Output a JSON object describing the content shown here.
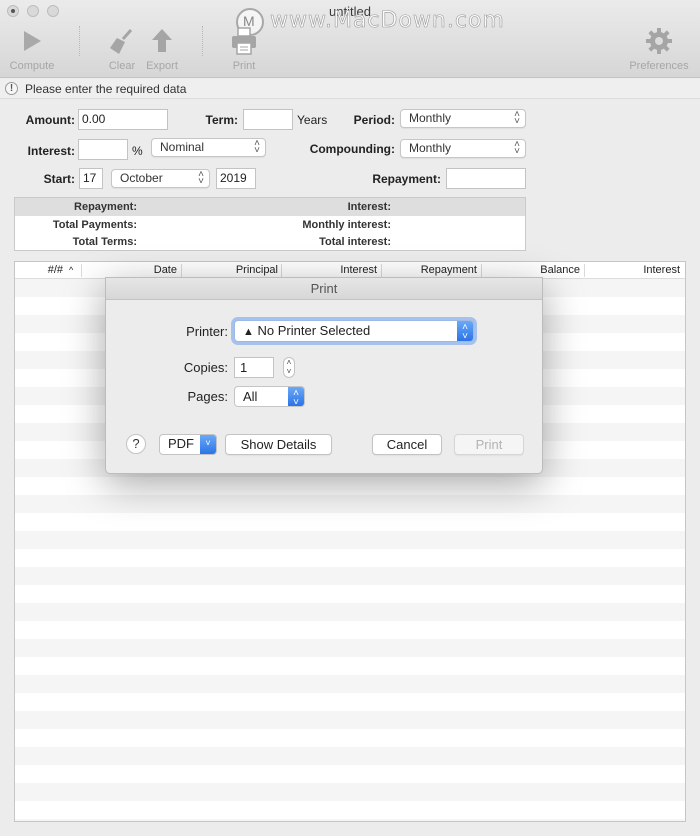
{
  "window": {
    "title": "untitled",
    "watermark": "www.MacDown.com"
  },
  "toolbar": {
    "compute": "Compute",
    "clear": "Clear",
    "export": "Export",
    "print": "Print",
    "preferences": "Preferences"
  },
  "status": {
    "icon": "!",
    "message": "Please enter the required data"
  },
  "form": {
    "amount_label": "Amount:",
    "amount_value": "0.00",
    "term_label": "Term:",
    "term_value": "",
    "term_unit": "Years",
    "period_label": "Period:",
    "period_value": "Monthly",
    "interest_label": "Interest:",
    "interest_value": "",
    "percent": "%",
    "rate_type": "Nominal",
    "compounding_label": "Compounding:",
    "compounding_value": "Monthly",
    "start_label": "Start:",
    "start_day": "17",
    "start_month": "October",
    "start_year": "2019",
    "repayment_label": "Repayment:",
    "repayment_value": ""
  },
  "summary": {
    "repayment": "Repayment:",
    "total_payments": "Total Payments:",
    "total_terms": "Total Terms:",
    "interest": "Interest:",
    "monthly_interest": "Monthly interest:",
    "total_interest": "Total interest:"
  },
  "table": {
    "columns": [
      "#/#",
      "Date",
      "Principal",
      "Interest",
      "Repayment",
      "Balance",
      "Interest"
    ],
    "sort_indicator": "^",
    "rows": []
  },
  "print_dialog": {
    "title": "Print",
    "printer_label": "Printer:",
    "printer_value": "No Printer Selected",
    "printer_warning_icon": "▲",
    "copies_label": "Copies:",
    "copies_value": "1",
    "pages_label": "Pages:",
    "pages_value": "All",
    "help": "?",
    "pdf": "PDF",
    "show_details": "Show Details",
    "cancel": "Cancel",
    "print": "Print"
  }
}
